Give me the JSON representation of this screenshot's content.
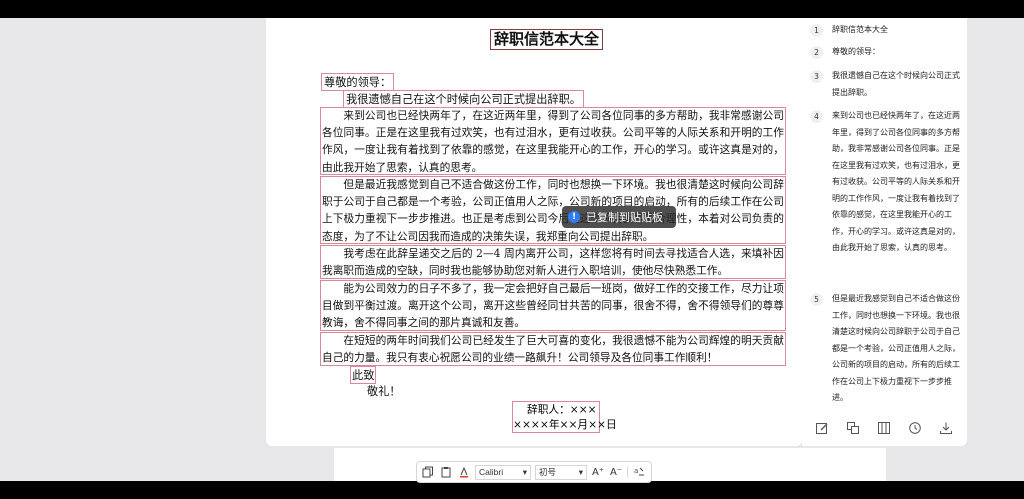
{
  "document": {
    "title": "辞职信范本大全",
    "greeting": "尊敬的领导：",
    "opening": "我很遗憾自己在这个时候向公司正式提出辞职。",
    "paragraphs": [
      "来到公司也已经快两年了，在这近两年里，得到了公司各位同事的多方帮助，我非常感谢公司各位同事。正是在这里我有过欢笑，也有过泪水，更有过收获。公司平等的人际关系和开明的工作作风，一度让我有着找到了依靠的感觉，在这里我能开心的工作，开心的学习。或许这真是对的，由此我开始了思索，认真的思考。",
      "但是最近我感觉到自己不适合做这份工作，同时也想换一下环境。我也很清楚这时候向公司辞职于公司于自己都是一个考验，公司正值用人之际，公司新的项目的启动，所有的后续工作在公司上下极力重视下一步步推进。也正是考虑到公司今后在这个项目安排的合理性，本着对公司负责的态度，为了不让公司因我而造成的决策失误，我郑重向公司提出辞职。",
      "我考虑在此辞呈递交之后的 2—4 周内离开公司，这样您将有时间去寻找适合人选，来填补因我离职而造成的空缺，同时我也能够协助您对新人进行入职培训，使他尽快熟悉工作。",
      "能为公司效力的日子不多了，我一定会把好自己最后一班岗，做好工作的交接工作，尽力让项目做到平衡过渡。离开这个公司，离开这些曾经同甘共苦的同事，很舍不得，舍不得领导们的尊尊教诲，舍不得同事之间的那片真诚和友善。",
      "在短短的两年时间我们公司已经发生了巨大可喜的变化，我很遗憾不能为公司辉煌的明天贡献自己的力量。我只有衷心祝愿公司的业绩一路飙升！公司领导及各位同事工作顺利！"
    ],
    "closing1": "此致",
    "closing2": "敬礼！",
    "signer": "辞职人：×××",
    "date": "××××年××月××日"
  },
  "toast": {
    "text": "已复制到贴贴板",
    "icon": "info-icon"
  },
  "toolbar": {
    "font": "Calibri",
    "size": "初号",
    "grow": "A⁺",
    "shrink": "A⁻"
  },
  "panel": {
    "items": [
      {
        "num": "1",
        "text": "辞职信范本大全"
      },
      {
        "num": "2",
        "text": "尊敬的领导："
      },
      {
        "num": "3",
        "text": "我很遗憾自己在这个时候向公司正式提出辞职。"
      },
      {
        "num": "4",
        "text": "来到公司也已经快两年了，在这近两年里，得到了公司各位同事的多方帮助，我非常感谢公司各位同事。正是在这里我有过欢笑，也有过泪水，更有过收获。公司平等的人际关系和开明的工作作风，一度让我有着找到了依靠的感觉，在这里我能开心的工作，开心的学习。或许这真是对的，由此我开始了思索，认真的思考。"
      },
      {
        "num": "5",
        "text": "但是最近我感觉到自己不适合做这份工作，同时也想换一下环境。我也很清楚这时候向公司辞职于公司于自己都是一个考验，公司正值用人之际，公司新的项目的启动，所有的后续工作在公司上下极力重视下一步步推进。"
      }
    ]
  },
  "colors": {
    "accent": "#2f7df6",
    "box": "#d88a9a"
  }
}
